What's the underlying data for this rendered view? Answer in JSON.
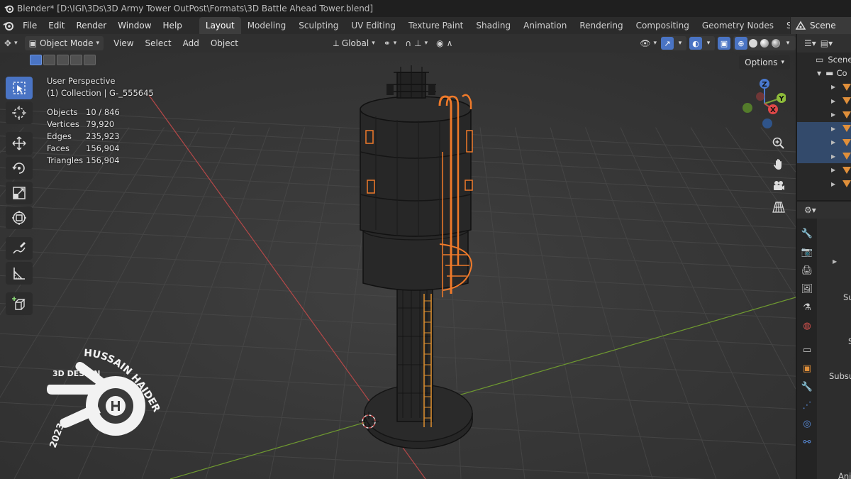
{
  "window": {
    "title": "Blender* [D:\\IGI\\3Ds\\3D Army Tower OutPost\\Formats\\3D Battle Ahead Tower.blend]"
  },
  "menu": {
    "file": "File",
    "edit": "Edit",
    "render": "Render",
    "window": "Window",
    "help": "Help"
  },
  "workspaces": [
    "Layout",
    "Modeling",
    "Sculpting",
    "UV Editing",
    "Texture Paint",
    "Shading",
    "Animation",
    "Rendering",
    "Compositing",
    "Geometry Nodes",
    "Scripting"
  ],
  "scene": {
    "label": "Scene"
  },
  "viewport_header": {
    "mode": "Object Mode",
    "view": "View",
    "select": "Select",
    "add": "Add",
    "object": "Object",
    "transform_orientation": "Global",
    "options": "Options"
  },
  "overlay": {
    "view_name": "User Perspective",
    "collection": "(1) Collection | G-_555645",
    "stats": [
      {
        "label": "Objects",
        "value": "10 / 846"
      },
      {
        "label": "Vertices",
        "value": "79,920"
      },
      {
        "label": "Edges",
        "value": "235,923"
      },
      {
        "label": "Faces",
        "value": "156,904"
      },
      {
        "label": "Triangles",
        "value": "156,904"
      }
    ]
  },
  "gizmo": {
    "x": "X",
    "y": "Y",
    "z": "Z"
  },
  "outliner": {
    "scene": "Scene",
    "collection": "Co"
  },
  "properties": {
    "labels": [
      "Su",
      "S",
      "Subsu",
      "Ani"
    ]
  },
  "watermark": {
    "name": "HUSSAIN HAIDER",
    "tagline": "3D DESIGN",
    "year": "2023"
  },
  "colors": {
    "accent": "#4a74c4",
    "viewport_bg": "#3a3a3a",
    "axis_x": "#c84a4a",
    "axis_y": "#7ea33a",
    "selection_orange": "#f07a2a",
    "object_tri": "#e08f3a"
  }
}
